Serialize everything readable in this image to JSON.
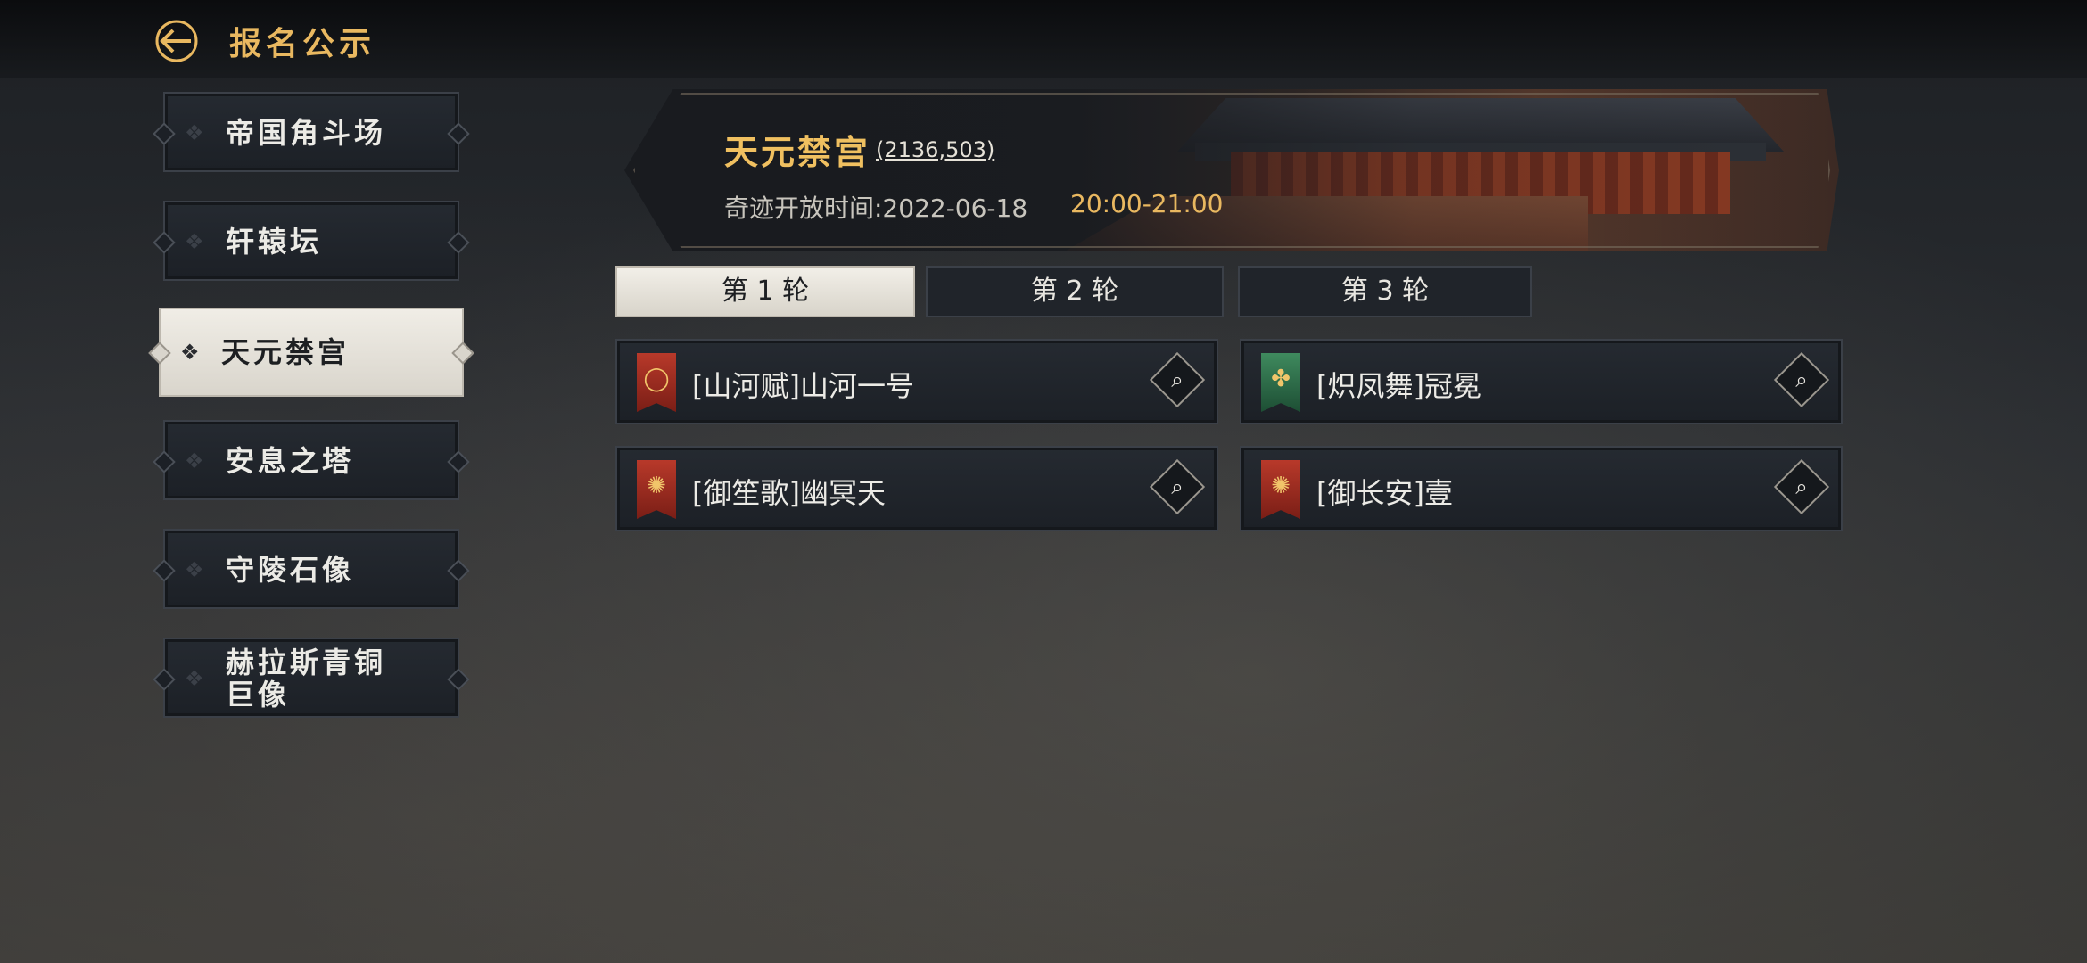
{
  "header": {
    "title": "报名公示",
    "back_icon": "back-arrow-icon"
  },
  "sidebar": {
    "items": [
      {
        "label": "帝国角斗场",
        "active": false
      },
      {
        "label": "轩辕坛",
        "active": false
      },
      {
        "label": "天元禁宫",
        "active": true
      },
      {
        "label": "安息之塔",
        "active": false
      },
      {
        "label": "守陵石像",
        "active": false
      },
      {
        "label": "赫拉斯青铜巨像",
        "active": false
      }
    ]
  },
  "wonder": {
    "name": "天元禁宫",
    "coords": "(2136,503)",
    "open_time_label": "奇迹开放时间:2022-06-18",
    "open_time_range": "20:00-21:00"
  },
  "rounds": {
    "tabs": [
      {
        "label": "第 1 轮",
        "active": true
      },
      {
        "label": "第 2 轮",
        "active": false
      },
      {
        "label": "第 3 轮",
        "active": false
      }
    ]
  },
  "alliances": [
    {
      "name": "[山河赋]山河一号",
      "flag_color": "#a83225",
      "emblem": "laurel-emblem-icon"
    },
    {
      "name": "[炽凤舞]冠冕",
      "flag_color": "#2f7048",
      "emblem": "phoenix-emblem-icon"
    },
    {
      "name": "[御笙歌]幽冥天",
      "flag_color": "#a83225",
      "emblem": "dragon-emblem-icon"
    },
    {
      "name": "[御长安]壹",
      "flag_color": "#a83225",
      "emblem": "dragon-emblem-icon"
    }
  ],
  "colors": {
    "accent_gold": "#e9b860",
    "panel": "#20242a",
    "active_panel": "#ebe7df"
  }
}
